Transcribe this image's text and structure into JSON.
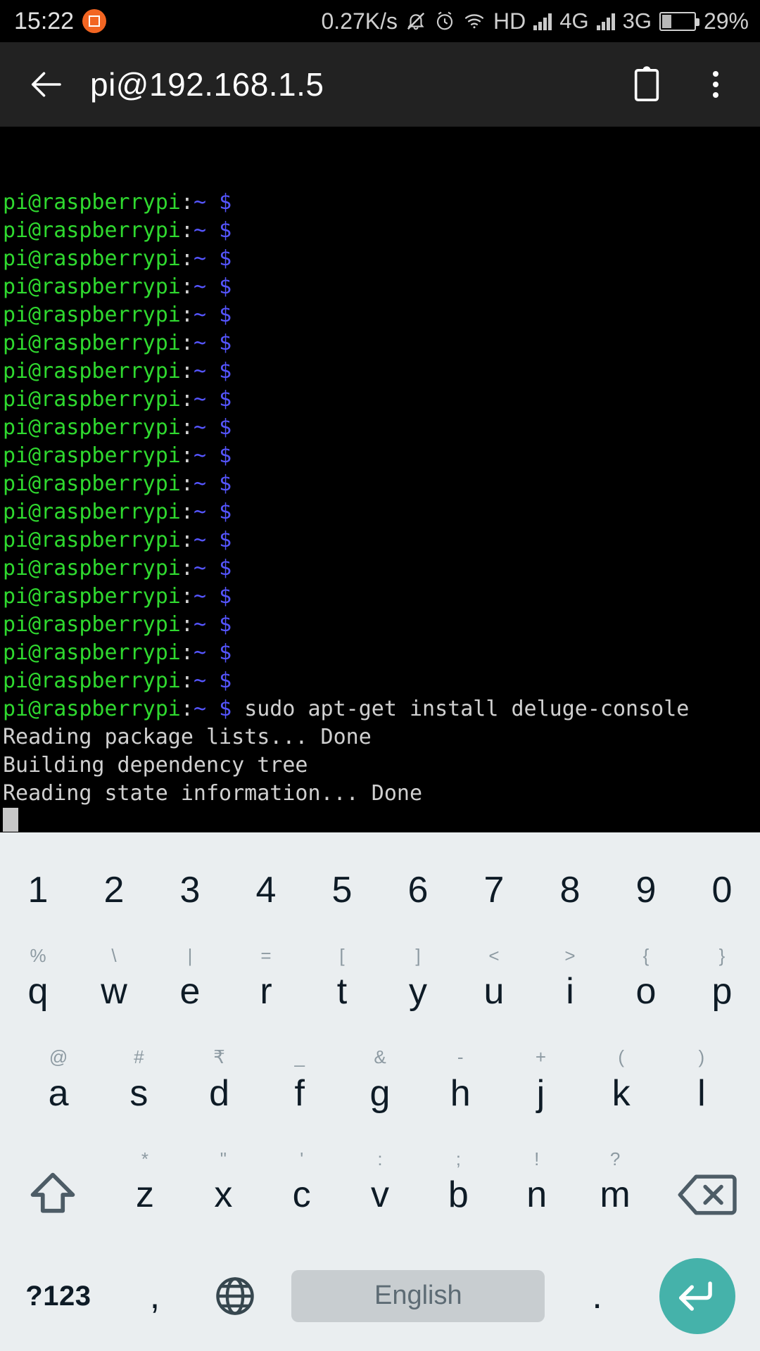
{
  "status_bar": {
    "clock": "15:22",
    "app_badge_icon": "screenshot-app-icon",
    "badge_color": "#f26522",
    "net_speed": "0.27K/s",
    "icons": [
      "mute-bell-icon",
      "alarm-clock-icon",
      "wifi-icon"
    ],
    "hd_label": "HD",
    "sim1_label": "4G",
    "sim2_label": "3G",
    "battery_percent": "29%",
    "battery_level": 29,
    "text_color": "#cfcfcf"
  },
  "app_bar": {
    "back_icon": "arrow-left-icon",
    "title": "pi@192.168.1.5",
    "clipboard_icon": "clipboard-icon",
    "overflow_icon": "more-vertical-icon",
    "background": "#222222"
  },
  "terminal": {
    "background": "#000000",
    "prompt_user_host": "pi@raspberrypi",
    "prompt_colon": ":",
    "prompt_path": "~",
    "prompt_symbol": "$",
    "colors": {
      "user_host": "#2fd92f",
      "colon": "#d0d0d0",
      "path": "#5555ff",
      "symbol": "#5555ff",
      "output": "#d0d0d0"
    },
    "empty_prompt_count": 18,
    "command": "sudo apt-get install deluge-console",
    "output_lines": [
      "Reading package lists... Done",
      "Building dependency tree",
      "Reading state information... Done"
    ],
    "cursor": "block-cursor"
  },
  "keyboard": {
    "background": "#eaeef0",
    "key_text_color": "#0e1b26",
    "hint_text_color": "#8d9aa2",
    "rows": {
      "numbers": [
        {
          "main": "1",
          "hint": ""
        },
        {
          "main": "2",
          "hint": ""
        },
        {
          "main": "3",
          "hint": ""
        },
        {
          "main": "4",
          "hint": ""
        },
        {
          "main": "5",
          "hint": ""
        },
        {
          "main": "6",
          "hint": ""
        },
        {
          "main": "7",
          "hint": ""
        },
        {
          "main": "8",
          "hint": ""
        },
        {
          "main": "9",
          "hint": ""
        },
        {
          "main": "0",
          "hint": ""
        }
      ],
      "top": [
        {
          "main": "q",
          "hint": "%"
        },
        {
          "main": "w",
          "hint": "\\"
        },
        {
          "main": "e",
          "hint": "|"
        },
        {
          "main": "r",
          "hint": "="
        },
        {
          "main": "t",
          "hint": "["
        },
        {
          "main": "y",
          "hint": "]"
        },
        {
          "main": "u",
          "hint": "<"
        },
        {
          "main": "i",
          "hint": ">"
        },
        {
          "main": "o",
          "hint": "{"
        },
        {
          "main": "p",
          "hint": "}"
        }
      ],
      "home": [
        {
          "main": "a",
          "hint": "@"
        },
        {
          "main": "s",
          "hint": "#"
        },
        {
          "main": "d",
          "hint": "₹"
        },
        {
          "main": "f",
          "hint": "_"
        },
        {
          "main": "g",
          "hint": "&"
        },
        {
          "main": "h",
          "hint": "-"
        },
        {
          "main": "j",
          "hint": "+"
        },
        {
          "main": "k",
          "hint": "("
        },
        {
          "main": "l",
          "hint": ")"
        }
      ],
      "bottom_letters": [
        {
          "main": "z",
          "hint": "*"
        },
        {
          "main": "x",
          "hint": "\""
        },
        {
          "main": "c",
          "hint": "'"
        },
        {
          "main": "v",
          "hint": ":"
        },
        {
          "main": "b",
          "hint": ";"
        },
        {
          "main": "n",
          "hint": "!"
        },
        {
          "main": "m",
          "hint": "?"
        }
      ]
    },
    "shift_icon": "shift-arrow-up-icon",
    "backspace_icon": "backspace-delete-icon",
    "symbols_key_label": "?123",
    "comma_key_label": ",",
    "globe_icon": "language-globe-icon",
    "space_label": "English",
    "space_bg": "#c8cdd0",
    "period_key_label": ".",
    "enter_icon": "enter-return-icon",
    "enter_color": "#45b2aa"
  }
}
